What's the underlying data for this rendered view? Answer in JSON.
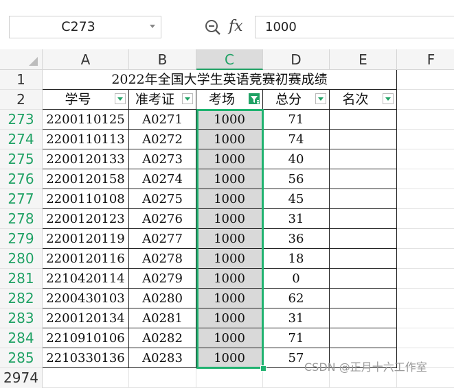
{
  "formula_bar": {
    "name_box": "C273",
    "fx_label": "fx",
    "formula_value": "1000"
  },
  "columns": [
    "A",
    "B",
    "C",
    "D",
    "E",
    "F"
  ],
  "title_row": {
    "row": "1",
    "text": "2022年全国大学生英语竞赛初赛成绩"
  },
  "header_row": {
    "row": "2",
    "labels": [
      "学号",
      "准考证",
      "考场",
      "总分",
      "名次"
    ]
  },
  "rows": [
    {
      "row": "273",
      "id": "2200110125",
      "ticket": "A0271",
      "room": "1000",
      "score": "71"
    },
    {
      "row": "274",
      "id": "2200110113",
      "ticket": "A0272",
      "room": "1000",
      "score": "74"
    },
    {
      "row": "275",
      "id": "2200120133",
      "ticket": "A0273",
      "room": "1000",
      "score": "40"
    },
    {
      "row": "276",
      "id": "2200120158",
      "ticket": "A0274",
      "room": "1000",
      "score": "56"
    },
    {
      "row": "277",
      "id": "2200110108",
      "ticket": "A0275",
      "room": "1000",
      "score": "45"
    },
    {
      "row": "278",
      "id": "2200120123",
      "ticket": "A0276",
      "room": "1000",
      "score": "31"
    },
    {
      "row": "279",
      "id": "2200120119",
      "ticket": "A0277",
      "room": "1000",
      "score": "36"
    },
    {
      "row": "280",
      "id": "2200120116",
      "ticket": "A0278",
      "room": "1000",
      "score": "18"
    },
    {
      "row": "281",
      "id": "2210420114",
      "ticket": "A0279",
      "room": "1000",
      "score": "0"
    },
    {
      "row": "282",
      "id": "2200430103",
      "ticket": "A0280",
      "room": "1000",
      "score": "62"
    },
    {
      "row": "283",
      "id": "2200120134",
      "ticket": "A0281",
      "room": "1000",
      "score": "31"
    },
    {
      "row": "284",
      "id": "2210910106",
      "ticket": "A0282",
      "room": "1000",
      "score": "71"
    },
    {
      "row": "285",
      "id": "2210330136",
      "ticket": "A0283",
      "room": "1000",
      "score": "57"
    }
  ],
  "next_row": "2974",
  "watermark": "CSDN @正月十六工作室",
  "colors": {
    "accent": "#20a265",
    "selection_fill": "#d9d9d9"
  }
}
